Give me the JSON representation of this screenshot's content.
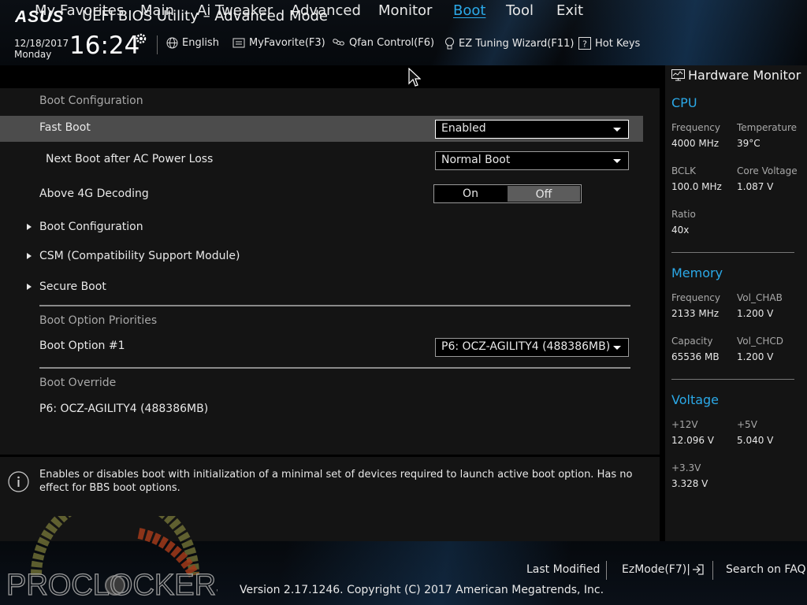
{
  "header": {
    "brand": "ASUS",
    "app_title": "UEFI BIOS Utility – Advanced Mode",
    "date": "12/18/2017",
    "day": "Monday",
    "time": "16:24",
    "toolbar": [
      {
        "label": "English",
        "icon": "globe-icon"
      },
      {
        "label": "MyFavorite(F3)",
        "icon": "favorite-icon"
      },
      {
        "label": "Qfan Control(F6)",
        "icon": "fan-icon"
      },
      {
        "label": "EZ Tuning Wizard(F11)",
        "icon": "lightbulb-icon"
      },
      {
        "label": "Hot Keys",
        "icon": "question-icon"
      }
    ]
  },
  "nav": {
    "tabs": [
      "My Favorites",
      "Main",
      "Ai Tweaker",
      "Advanced",
      "Monitor",
      "Boot",
      "Tool",
      "Exit"
    ],
    "active": "Boot"
  },
  "boot": {
    "section_config": "Boot Configuration",
    "fast_boot_label": "Fast Boot",
    "fast_boot_value": "Enabled",
    "next_boot_label": "Next Boot after AC Power Loss",
    "next_boot_value": "Normal Boot",
    "above4g_label": "Above 4G Decoding",
    "above4g_on": "On",
    "above4g_off": "Off",
    "above4g_selected": "Off",
    "submenus": [
      "Boot Configuration",
      "CSM (Compatibility Support Module)",
      "Secure Boot"
    ],
    "section_priorities": "Boot Option Priorities",
    "option1_label": "Boot Option #1",
    "option1_value": "P6: OCZ-AGILITY4  (488386MB)",
    "section_override": "Boot Override",
    "override_item": "P6: OCZ-AGILITY4  (488386MB)"
  },
  "info": {
    "text": "Enables or disables boot with initialization of a minimal set of devices required to launch active boot option. Has no effect for BBS boot options."
  },
  "hw": {
    "title": "Hardware Monitor",
    "cpu": {
      "title": "CPU",
      "freq_label": "Frequency",
      "freq": "4000 MHz",
      "temp_label": "Temperature",
      "temp": "39°C",
      "bclk_label": "BCLK",
      "bclk": "100.0 MHz",
      "vcore_label": "Core Voltage",
      "vcore": "1.087 V",
      "ratio_label": "Ratio",
      "ratio": "40x"
    },
    "memory": {
      "title": "Memory",
      "freq_label": "Frequency",
      "freq": "2133 MHz",
      "volab_label": "Vol_CHAB",
      "volab": "1.200 V",
      "cap_label": "Capacity",
      "cap": "65536 MB",
      "volcd_label": "Vol_CHCD",
      "volcd": "1.200 V"
    },
    "voltage": {
      "title": "Voltage",
      "v12_label": "+12V",
      "v12": "12.096 V",
      "v5_label": "+5V",
      "v5": "5.040 V",
      "v33_label": "+3.3V",
      "v33": "3.328 V"
    }
  },
  "footer": {
    "last_modified": "Last Modified",
    "ezmode": "EzMode(F7)|",
    "search": "Search on FAQ",
    "version": "Version 2.17.1246. Copyright (C) 2017 American Megatrends, Inc.",
    "watermark": "PROCLOCKERS"
  },
  "colors": {
    "accent": "#2ba9e8",
    "highlight_row": "#4c4c4c",
    "panel_bg": "#141414"
  }
}
